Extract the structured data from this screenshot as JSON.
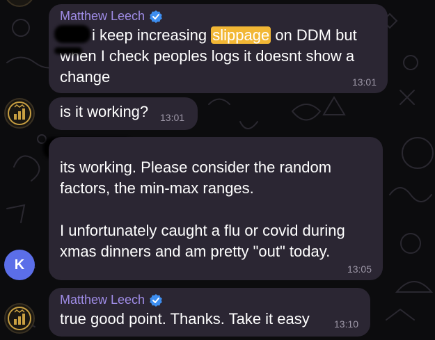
{
  "chat": {
    "messages": [
      {
        "sender": "Matthew Leech",
        "line1_before": "i keep increasing",
        "highlight": "slippage",
        "line1_after": "on DDM but",
        "line2": "when I check peoples logs it doesnt show a",
        "line3": "change",
        "time": "13:01"
      },
      {
        "text": "is it working?",
        "time": "13:01"
      },
      {
        "line1": "its working. Please consider the random",
        "line2": "factors, the min-max ranges.",
        "line3": "I unfortunately caught a flu or covid during",
        "line4": "xmas dinners and am pretty \"out\" today.",
        "time": "13:05",
        "avatar_letter": "K"
      },
      {
        "sender": "Matthew Leech",
        "text": "true good point. Thanks. Take it easy",
        "time": "13:10"
      }
    ]
  },
  "colors": {
    "background": "#0c0c0e",
    "bubble": "#2b2633",
    "sender_name": "#9f8ce6",
    "highlight": "#f2b735",
    "avatar_k": "#5b6ee8",
    "verified": "#3d8ef0"
  },
  "icons": [
    "verified-badge-icon",
    "bar-chart-logo-icon"
  ]
}
